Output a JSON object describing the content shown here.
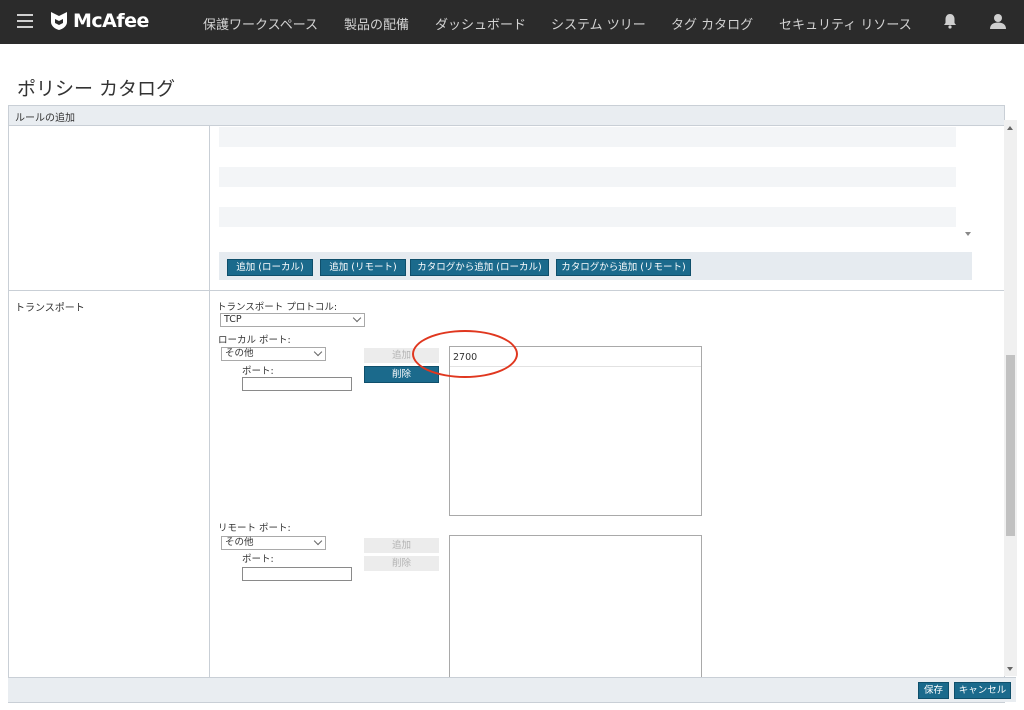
{
  "nav": {
    "brand": "McAfee",
    "items": [
      "保護ワークスペース",
      "製品の配備",
      "ダッシュボード",
      "システム ツリー",
      "タグ カタログ",
      "セキュリティ リソース"
    ]
  },
  "page": {
    "title": "ポリシー カタログ",
    "section_header": "ルールの追加",
    "transport_label": "トランスポート"
  },
  "rules": {
    "buttons": [
      "追加 (ローカル)",
      "追加 (リモート)",
      "カタログから追加 (ローカル)",
      "カタログから追加 (リモート)"
    ]
  },
  "transport": {
    "protocol_label": "トランスポート プロトコル:",
    "protocol_value": "TCP",
    "local_port_label": "ローカル ポート:",
    "local_port_type": "その他",
    "local_port_field_label": "ポート:",
    "local_port_input_value": "",
    "local_add": "追加",
    "local_delete": "削除",
    "local_ports": [
      "2700"
    ],
    "remote_port_label": "リモート ポート:",
    "remote_port_type": "その他",
    "remote_port_field_label": "ポート:",
    "remote_port_input_value": "",
    "remote_add": "追加",
    "remote_delete": "削除",
    "remote_ports": []
  },
  "footer": {
    "save": "保存",
    "cancel": "キャンセル"
  },
  "colors": {
    "topbar": "#2b2b2b",
    "primary_button": "#1b6a8c",
    "annotation": "#e0371f"
  }
}
